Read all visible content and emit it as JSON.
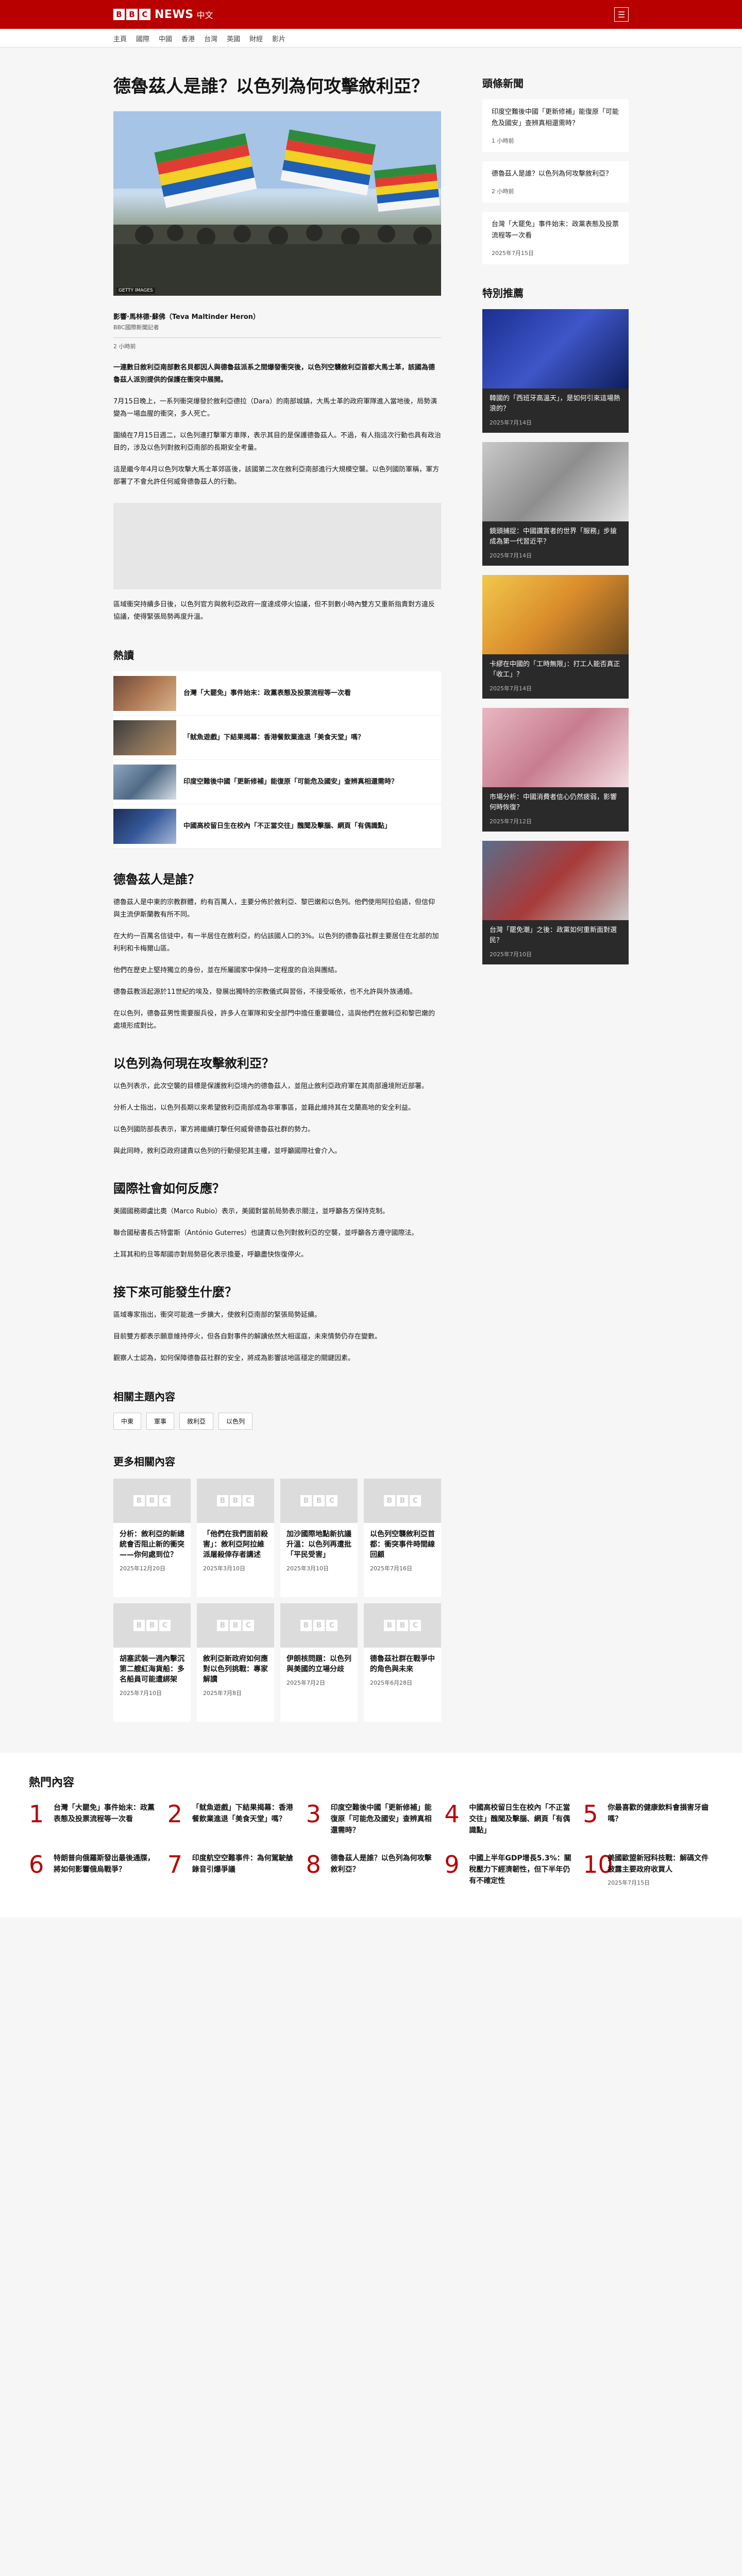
{
  "header": {
    "logo_letters": [
      "B",
      "B",
      "C"
    ],
    "brand": "NEWS",
    "brand_sub": "中文",
    "menu_icon": "☰",
    "nav": [
      "主頁",
      "國際",
      "中國",
      "香港",
      "台灣",
      "英國",
      "財經",
      "影片"
    ]
  },
  "article": {
    "title": "德魯茲人是誰？以色列為何攻擊敘利亞？",
    "hero_caption": "GETTY IMAGES",
    "author": "影響·馬林德·蘇佛（Teva Maltinder Heron）",
    "role": "BBC國際新聞記者",
    "date": "2 小時前",
    "lede": "一連數日敘利亞南部數名貝都因人與德魯茲派系之間爆發衝突後，以色列空襲敘利亞首都大馬士革，該國為德魯茲人派別提供的保護在衝突中展開。",
    "paras": [
      "7月15日晚上，一系列衝突爆發於敘利亞德拉（Dara）的南部城鎮，大馬士革的政府軍隊進入當地後，局勢演變為一場血腥的衝突，多人死亡。",
      "圍繞在7月15日週二，以色列連打擊軍方車隊，表示其目的是保護德魯茲人。不過，有人指這次行動也具有政治目的，涉及以色列對敘利亞南部的長期安全考量。",
      "這是繼今年4月以色列攻擊大馬士革郊區後，該國第二次在敘利亞南部進行大規模空襲。以色列國防軍稱，軍方部署了不會允許任何威脅德魯茲人的行動。"
    ],
    "after_ad": "區域衝突持續多日後，以色列官方與敘利亞政府一度達成停火協議，但不到數小時內雙方又重新指責對方違反協議，使得緊張局勢再度升溫。"
  },
  "hot": {
    "heading": "熱讀",
    "items": [
      "台灣「大罷免」事件始末：政黨表態及投票流程等一次看",
      "「鱿魚遊戲」下結果揭幕：香港餐飲業進退「美食天堂」嗎？",
      "印度空難後中國「更新修補」能復原「可能危及國安」查辨真相還需時？",
      "中國高校留日生在校內「不正當交往」醜聞及擊腦、網頁「有偶識點」"
    ]
  },
  "sections": [
    {
      "heading": "德魯茲人是誰？",
      "paras": [
        "德魯茲人是中東的宗教群體，約有百萬人，主要分佈於敘利亞、黎巴嫩和以色列。他們使用阿拉伯語，但信仰與主流伊斯蘭教有所不同。",
        "在大約一百萬名信徒中，有一半居住在敘利亞，約佔該國人口的3%。以色列的德魯茲社群主要居住在北部的加利利和卡梅爾山區。",
        "他們在歷史上堅持獨立的身份，並在所屬國家中保持一定程度的自治與團結。",
        "德魯茲教派起源於11世紀的埃及，發展出獨特的宗教儀式與習俗，不接受皈依，也不允許與外族通婚。",
        "在以色列，德魯茲男性需要服兵役，許多人在軍隊和安全部門中擔任重要職位，這與他們在敘利亞和黎巴嫩的處境形成對比。"
      ]
    },
    {
      "heading": "以色列為何現在攻擊敘利亞？",
      "paras": [
        "以色列表示，此次空襲的目標是保護敘利亞境內的德魯茲人，並阻止敘利亞政府軍在其南部邊境附近部署。",
        "分析人士指出，以色列長期以來希望敘利亞南部成為非軍事區，並藉此維持其在戈蘭高地的安全利益。",
        "以色列國防部長表示，軍方將繼續打擊任何威脅德魯茲社群的勢力。",
        "與此同時，敘利亞政府譴責以色列的行動侵犯其主權，並呼籲國際社會介入。"
      ]
    },
    {
      "heading": "國際社會如何反應？",
      "paras": [
        "美國國務卿盧比奧（Marco Rubio）表示，美國對當前局勢表示關注，並呼籲各方保持克制。",
        "聯合國秘書長古特雷斯（António Guterres）也譴責以色列對敘利亞的空襲，並呼籲各方遵守國際法。",
        "土耳其和約旦等鄰國亦對局勢惡化表示擔憂，呼籲盡快恢復停火。"
      ]
    },
    {
      "heading": "接下來可能發生什麼？",
      "paras": [
        "區域專家指出，衝突可能進一步擴大，使敘利亞南部的緊張局勢延續。",
        "目前雙方都表示願意維持停火，但各自對事件的解讀依然大相逕庭，未來情勢仍存在變數。",
        "觀察人士認為，如何保障德魯茲社群的安全，將成為影響該地區穩定的關鍵因素。"
      ]
    }
  ],
  "topics": {
    "heading": "相關主題內容",
    "chips": [
      "中東",
      "軍事",
      "敘利亞",
      "以色列"
    ]
  },
  "more": {
    "heading": "更多相關內容",
    "cards": [
      {
        "title": "分析：敘利亞的新總統會否阻止新的衝突——你何處到位？",
        "date": "2025年12月20日"
      },
      {
        "title": "「他們在我們面前殺害」：敘利亞阿拉維派屠殺倖存者講述",
        "date": "2025年3月10日"
      },
      {
        "title": "加沙國際地點新抗議升溫：以色列再遭批「平民受害」",
        "date": "2025年3月10日"
      },
      {
        "title": "以色列空襲敘利亞首都：衝突事件時間線回顧",
        "date": "2025年7月16日"
      },
      {
        "title": "胡塞武裝一週內擊沉第二艘紅海貨船：多名船員可能遭綁架",
        "date": "2025年7月10日"
      },
      {
        "title": "敘利亞新政府如何應對以色列挑戰：專家解讀",
        "date": "2025年7月8日"
      },
      {
        "title": "伊朗核問題：以色列與美國的立場分歧",
        "date": "2025年7月2日"
      },
      {
        "title": "德魯茲社群在戰爭中的角色與未來",
        "date": "2025年6月28日"
      }
    ]
  },
  "side": {
    "news_heading": "頭條新聞",
    "news": [
      {
        "title": "印度空難後中國「更新修補」能復原「可能危及國安」查辨真相還需時？",
        "date": "1 小時前"
      },
      {
        "title": "德魯茲人是誰？以色列為何攻擊敘利亞？",
        "date": "2 小時前"
      },
      {
        "title": "台灣「大罷免」事件始末：政黨表態及投票流程等一次看",
        "date": "2025年7月15日"
      }
    ],
    "featured_heading": "特別推薦",
    "featured": [
      {
        "title": "韓國的「西班牙高溫天」，是如何引來這場熱浪的？",
        "date": "2025年7月14日"
      },
      {
        "title": "鏡頭捕捉：中國讚賞者的世界「服務」步搶成為第一代習近平？",
        "date": "2025年7月14日"
      },
      {
        "title": "卡繆在中國的「工時無限」：打工人能否真正「收工」？",
        "date": "2025年7月14日"
      },
      {
        "title": "市場分析：中國消費者信心仍然疲弱，影響何時恢復？",
        "date": "2025年7月12日"
      },
      {
        "title": "台灣「罷免潮」之後：政黨如何重新面對選民？",
        "date": "2025年7月10日"
      }
    ]
  },
  "popular": {
    "heading": "熱門內容",
    "items": [
      {
        "num": "1",
        "title": "台灣「大罷免」事件始末：政黨表態及投票流程等一次看"
      },
      {
        "num": "2",
        "title": "「鱿魚遊戲」下結果揭幕：香港餐飲業進退「美食天堂」嗎？"
      },
      {
        "num": "3",
        "title": "印度空難後中國「更新修補」能復原「可能危及國安」查辨真相還需時？"
      },
      {
        "num": "4",
        "title": "中國高校留日生在校內「不正當交往」醜聞及擊腦、網頁「有偶識點」"
      },
      {
        "num": "5",
        "title": "你最喜歡的健康飲料會損害牙齒嗎？"
      },
      {
        "num": "6",
        "title": "特朗普向俄羅斯發出最後通牒，將如何影響俄烏戰爭？"
      },
      {
        "num": "7",
        "title": "印度航空空難事件：為何駕駛艙錄音引爆爭議"
      },
      {
        "num": "8",
        "title": "德魯茲人是誰？以色列為何攻擊敘利亞？"
      },
      {
        "num": "9",
        "title": "中國上半年GDP增長5.3%：關稅壓力下經濟韌性，但下半年仍有不確定性"
      },
      {
        "num": "10",
        "title": "美國歐盟新冠科技戰：解碼文件披露主要政府收買人",
        "date": "2025年7月15日"
      }
    ]
  }
}
